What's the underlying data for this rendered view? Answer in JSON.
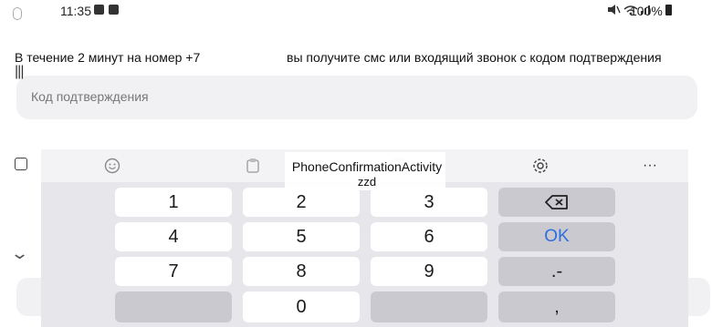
{
  "status_bar": {
    "time": "11:35",
    "battery": "100%"
  },
  "page": {
    "info_left": "В течение 2 минут на номер +7",
    "info_right": "вы получите смс или входящий звонок с кодом подтверждения",
    "code_placeholder": "Код подтверждения"
  },
  "overlay": {
    "activity": "PhoneConfirmationActivity",
    "sub": "zzd"
  },
  "keyboard": {
    "toolbar_icons": [
      "emoji-icon",
      "clipboard-icon",
      "settings-icon",
      "more-icon"
    ],
    "keys": {
      "k1": "1",
      "k2": "2",
      "k3": "3",
      "k4": "4",
      "k5": "5",
      "k6": "6",
      "k7": "7",
      "k8": "8",
      "k9": "9",
      "k0": "0",
      "ok": "OK",
      "dot_dash": ".-",
      "comma": ","
    },
    "more_glyph": "···",
    "accent_color": "#2e6fde"
  }
}
